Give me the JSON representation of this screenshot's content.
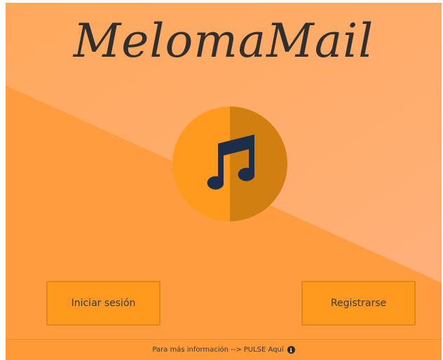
{
  "app": {
    "title": "MelomaMail"
  },
  "logo": {
    "icon": "music-note-icon",
    "circle_color": "#ff9a1e",
    "shade_color": "#d07f10",
    "note_color": "#1d2e4a"
  },
  "buttons": {
    "login_label": "Iniciar sesión",
    "register_label": "Registrarse"
  },
  "footer": {
    "info_text": "Para más información -->",
    "link_text": "PULSE Aquí",
    "icon": "info-icon"
  },
  "colors": {
    "background": "#ffa24e",
    "highlight": "#ffb273",
    "button": "#ff9a1e",
    "text": "#2f2f2f"
  }
}
